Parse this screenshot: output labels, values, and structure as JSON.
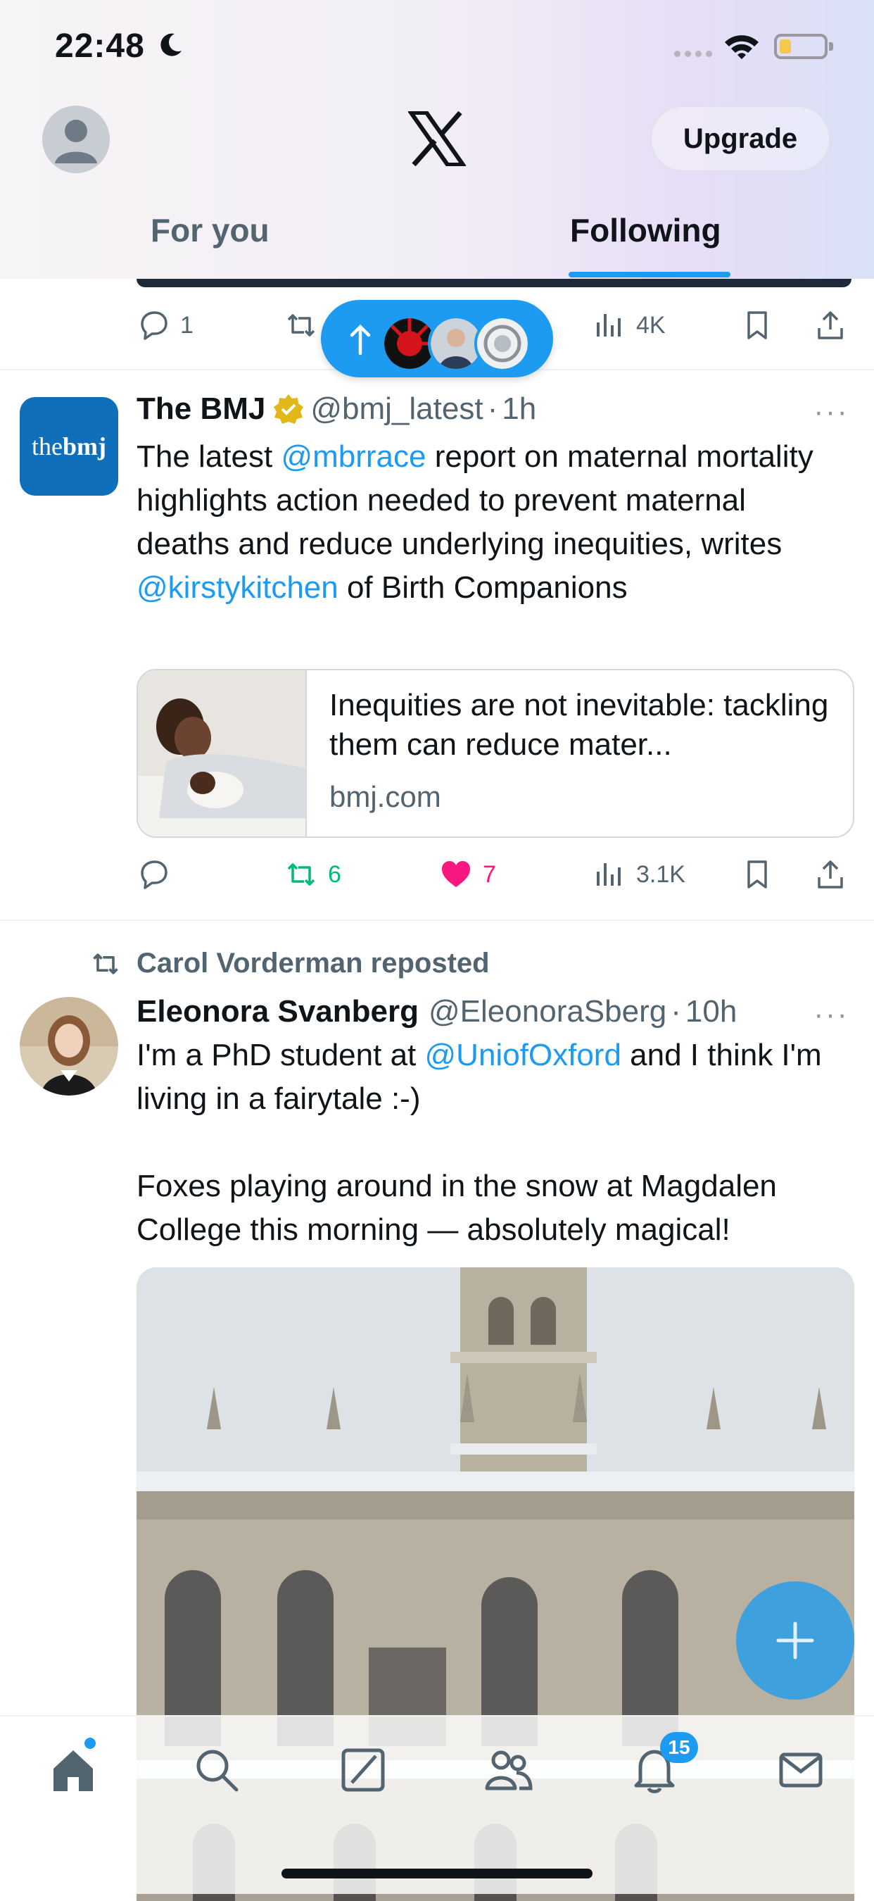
{
  "status_bar": {
    "time": "22:48"
  },
  "header": {
    "upgrade_label": "Upgrade",
    "tabs": [
      {
        "label": "For you",
        "selected": false
      },
      {
        "label": "Following",
        "selected": true
      }
    ]
  },
  "top_post_actions": {
    "replies": "1",
    "views": "4K"
  },
  "new_posts_pill": {
    "icon": "arrow-up-icon"
  },
  "posts": [
    {
      "avatar_text_a": "the",
      "avatar_text_b": "bmj",
      "name": "The BMJ",
      "verified": true,
      "handle": "@bmj_latest",
      "time": "1h",
      "text_parts": [
        "The latest ",
        "@mbrrace",
        " report on maternal mortality highlights action needed to prevent maternal deaths and reduce underlying inequities, writes ",
        "@kirstykitchen",
        " of Birth Companions"
      ],
      "card": {
        "title": "Inequities are not inevitable: tackling them can reduce mater...",
        "domain": "bmj.com"
      },
      "actions": {
        "replies": "",
        "reposts": "6",
        "likes": "7",
        "views": "3.1K"
      }
    },
    {
      "reposted_by": "Carol Vorderman reposted",
      "name": "Eleonora Svanberg",
      "handle": "@EleonoraSberg",
      "time": "10h",
      "text_line1_parts": [
        "I'm a PhD student at ",
        "@UniofOxford",
        " and I think I'm living in a fairytale :-)"
      ],
      "text_line2": "Foxes playing around in the snow at Magdalen College this morning — absolutely magical!"
    }
  ],
  "tab_bar": {
    "items": [
      "home-icon",
      "search-icon",
      "grok-icon",
      "communities-icon",
      "notifications-icon",
      "messages-icon"
    ],
    "notification_count": "15"
  },
  "colors": {
    "accent": "#1d9bf0",
    "repost_green": "#00ba7c",
    "like_pink": "#f91880",
    "muted": "#536471"
  }
}
